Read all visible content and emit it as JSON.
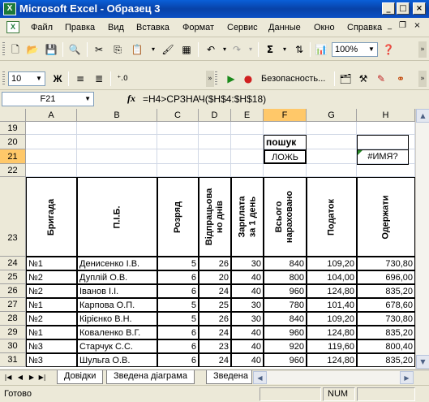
{
  "window": {
    "title": "Microsoft Excel - Образец 3"
  },
  "menu": {
    "items": [
      "Файл",
      "Правка",
      "Вид",
      "Вставка",
      "Формат",
      "Сервис",
      "Данные",
      "Окно",
      "Справка"
    ]
  },
  "toolbar": {
    "zoom": "100%",
    "font_size": "10",
    "bold": "Ж",
    "security_label": "Безопасность..."
  },
  "formula_bar": {
    "name_box": "F21",
    "fx": "fx",
    "formula": "=H4>СРЗНАЧ($H$4:$H$18)"
  },
  "columns": [
    "A",
    "B",
    "C",
    "D",
    "E",
    "F",
    "G",
    "H"
  ],
  "selected_column": "F",
  "rows": {
    "visible_numbers": [
      "19",
      "20",
      "21",
      "22",
      "23",
      "24",
      "25",
      "26",
      "27",
      "28",
      "29",
      "30",
      "31"
    ],
    "selected_row": "21"
  },
  "cells": {
    "F20": "пошук",
    "F21": "ЛОЖЬ",
    "H21": "#ИМЯ?"
  },
  "table": {
    "headers": [
      "Бригада",
      "П.І.Б.",
      "Розряд",
      "Відпрацьова но днів",
      "Зарплата за 1 день",
      "Всього нараховано",
      "Податок",
      "Одержати"
    ],
    "rows": [
      [
        "№1",
        "Денисенко І.В.",
        "5",
        "26",
        "30",
        "840",
        "109,20",
        "730,80"
      ],
      [
        "№2",
        "Дуплій О.В.",
        "6",
        "20",
        "40",
        "800",
        "104,00",
        "696,00"
      ],
      [
        "№2",
        "Іванов І.І.",
        "6",
        "24",
        "40",
        "960",
        "124,80",
        "835,20"
      ],
      [
        "№1",
        "Карпова О.П.",
        "5",
        "25",
        "30",
        "780",
        "101,40",
        "678,60"
      ],
      [
        "№2",
        "Кірієнко В.Н.",
        "5",
        "26",
        "30",
        "840",
        "109,20",
        "730,80"
      ],
      [
        "№1",
        "Коваленко В.Г.",
        "6",
        "24",
        "40",
        "960",
        "124,80",
        "835,20"
      ],
      [
        "№3",
        "Старчук С.С.",
        "6",
        "23",
        "40",
        "920",
        "119,60",
        "800,40"
      ],
      [
        "№3",
        "Шульга О.В.",
        "6",
        "24",
        "40",
        "960",
        "124,80",
        "835,20"
      ]
    ]
  },
  "sheet_tabs": [
    "Довідки",
    "Зведена діаграма",
    "Зведена"
  ],
  "status": {
    "ready": "Готово",
    "num": "NUM"
  }
}
